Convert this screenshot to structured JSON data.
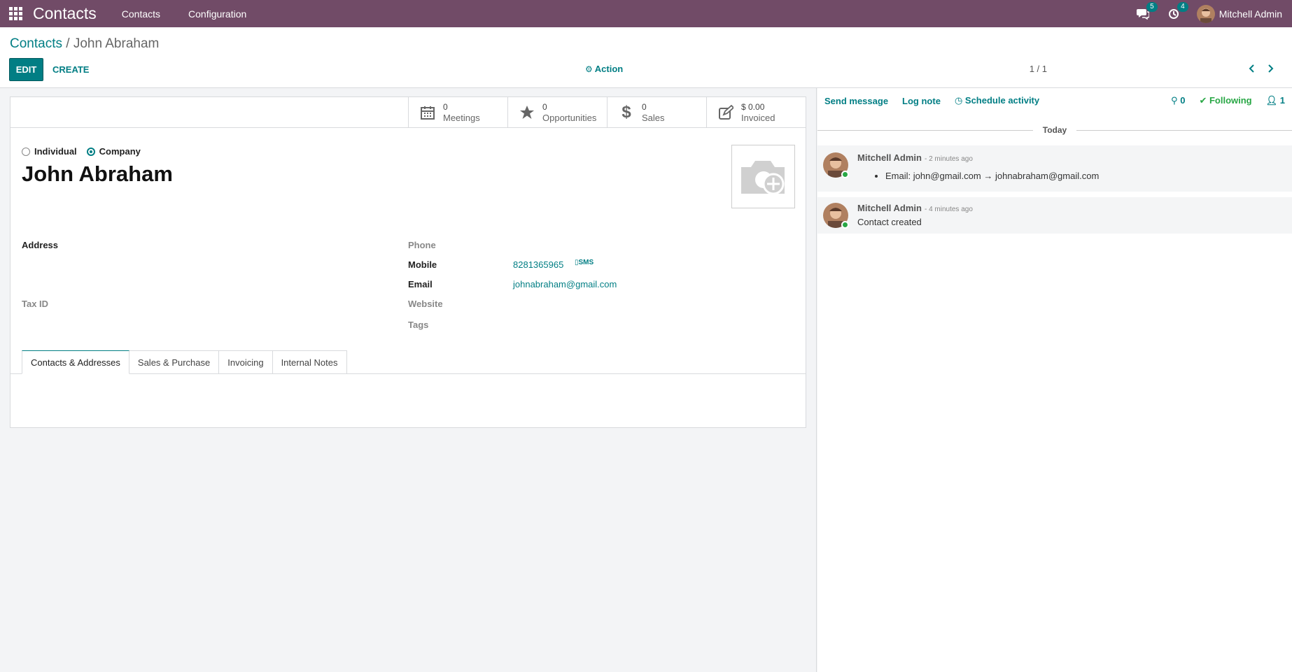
{
  "navbar": {
    "app_name": "Contacts",
    "menu": [
      "Contacts",
      "Configuration"
    ],
    "messages_count": "5",
    "activities_count": "4",
    "user_name": "Mitchell Admin"
  },
  "control_panel": {
    "breadcrumb_parent": "Contacts",
    "breadcrumb_sep": " / ",
    "breadcrumb_current": "John Abraham",
    "edit_label": "EDIT",
    "create_label": "CREATE",
    "action_label": "Action",
    "pager": "1 / 1"
  },
  "stat_buttons": [
    {
      "value": "0",
      "label": "Meetings",
      "icon": "calendar-icon"
    },
    {
      "value": "0",
      "label": "Opportunities",
      "icon": "star-icon"
    },
    {
      "value": "0",
      "label": "Sales",
      "icon": "dollar-icon"
    },
    {
      "value": "$ 0.00",
      "label": "Invoiced",
      "icon": "edit-icon"
    }
  ],
  "form": {
    "type_individual": "Individual",
    "type_company": "Company",
    "selected_type": "Company",
    "name": "John Abraham",
    "address_label": "Address",
    "tax_id_label": "Tax ID",
    "phone_label": "Phone",
    "mobile_label": "Mobile",
    "mobile_value": "8281365965",
    "sms_label": "SMS",
    "email_label": "Email",
    "email_value": "johnabraham@gmail.com",
    "website_label": "Website",
    "tags_label": "Tags"
  },
  "tabs": [
    "Contacts & Addresses",
    "Sales & Purchase",
    "Invoicing",
    "Internal Notes"
  ],
  "chatter": {
    "send_message": "Send message",
    "log_note": "Log note",
    "schedule_activity": "Schedule activity",
    "attachments_count": "0",
    "following_label": "Following",
    "followers_count": "1",
    "date_separator": "Today",
    "messages": [
      {
        "author": "Mitchell Admin",
        "time": "- 2 minutes ago",
        "body": "Email: john@gmail.com → johnabraham@gmail.com"
      },
      {
        "author": "Mitchell Admin",
        "time": "- 4 minutes ago",
        "body": "Contact created"
      }
    ]
  },
  "colors": {
    "navbar": "#714b67",
    "primary": "#017e84",
    "following": "#28a745"
  }
}
